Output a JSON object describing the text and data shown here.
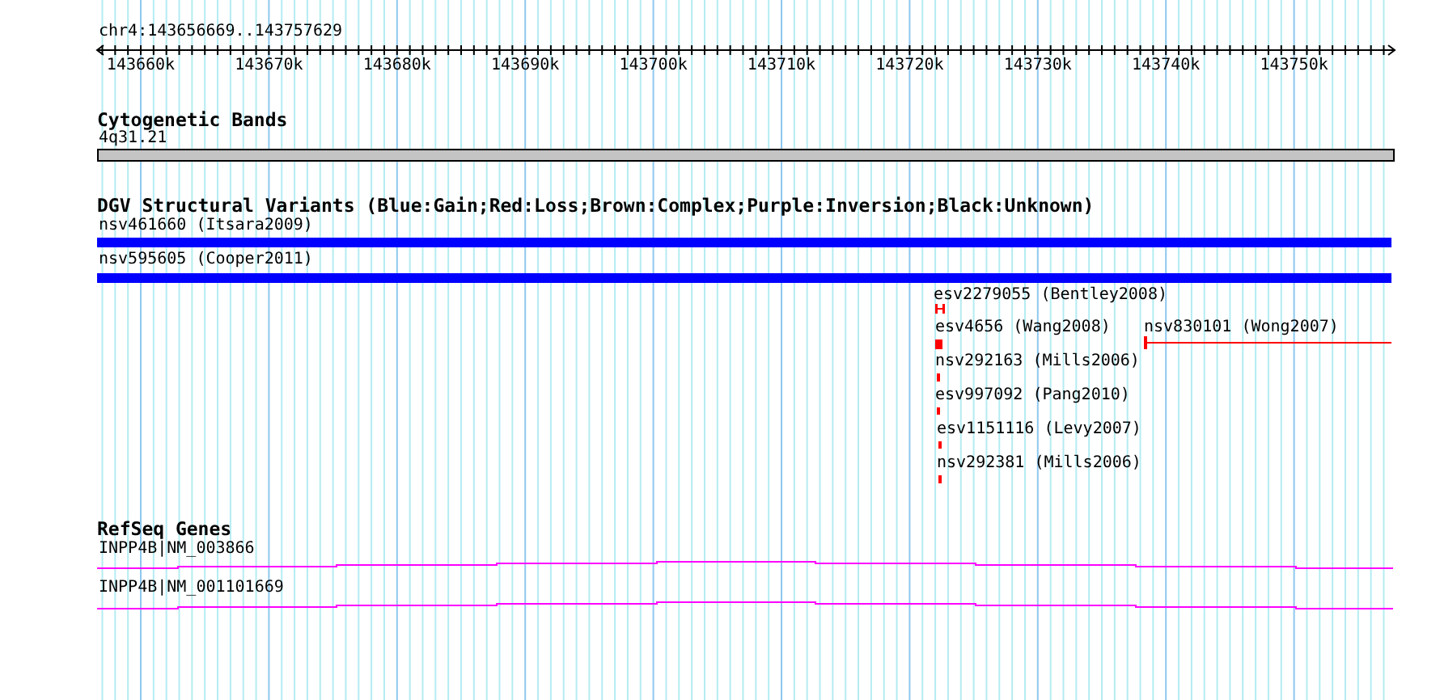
{
  "position": "chr4:143656669..143757629",
  "ruler": {
    "ticks": [
      "143660k",
      "143670k",
      "143680k",
      "143690k",
      "143700k",
      "143710k",
      "143720k",
      "143730k",
      "143740k",
      "143750k"
    ]
  },
  "tracks": [
    {
      "kind": "bands",
      "title": "Cytogenetic Bands",
      "items": [
        {
          "label": "4q31.21"
        }
      ]
    },
    {
      "kind": "variants",
      "title": "DGV Structural Variants (Blue:Gain;Red:Loss;Brown:Complex;Purple:Inversion;Black:Unknown)",
      "items": [
        {
          "label": "nsv461660 (Itsara2009)",
          "color": "#0000ff"
        },
        {
          "label": "nsv595605 (Cooper2011)",
          "color": "#0000ff"
        },
        {
          "label": "esv2279055 (Bentley2008)",
          "color": "#ff0000"
        },
        {
          "label": "esv4656 (Wang2008)",
          "color": "#ff0000"
        },
        {
          "label": "nsv830101 (Wong2007)",
          "color": "#ff0000"
        },
        {
          "label": "nsv292163 (Mills2006)",
          "color": "#ff0000"
        },
        {
          "label": "esv997092 (Pang2010)",
          "color": "#ff0000"
        },
        {
          "label": "esv1151116 (Levy2007)",
          "color": "#ff0000"
        },
        {
          "label": "nsv292381 (Mills2006)",
          "color": "#ff0000"
        }
      ]
    },
    {
      "kind": "genes",
      "title": "RefSeq Genes",
      "items": [
        {
          "label": "INPP4B|NM_003866"
        },
        {
          "label": "INPP4B|NM_001101669"
        }
      ]
    }
  ]
}
